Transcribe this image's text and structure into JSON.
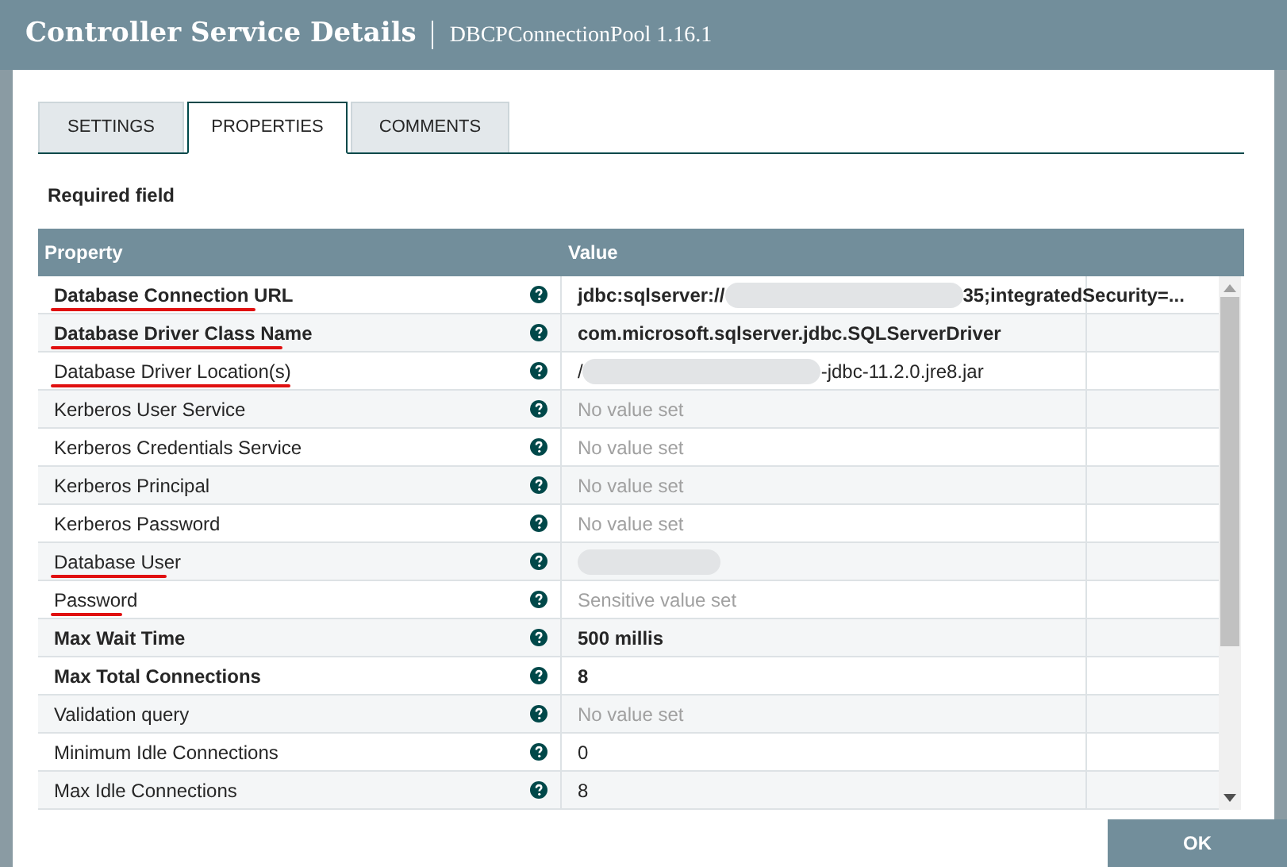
{
  "dialog": {
    "title": "Controller Service Details",
    "subtitle": "DBCPConnectionPool 1.16.1"
  },
  "tabs": [
    {
      "label": "SETTINGS",
      "selected": false
    },
    {
      "label": "PROPERTIES",
      "selected": true
    },
    {
      "label": "COMMENTS",
      "selected": false
    }
  ],
  "required_note": "Required field",
  "table": {
    "columns": [
      "Property",
      "Value"
    ],
    "rows": [
      {
        "name": "Database Connection URL",
        "required": true,
        "underlined": true,
        "value": "jdbc:sqlserver://",
        "redacted": true,
        "value_suffix": "35;integratedSecurity=...",
        "kind": "set"
      },
      {
        "name": "Database Driver Class Name",
        "required": true,
        "underlined": true,
        "value": "com.microsoft.sqlserver.jdbc.SQLServerDriver",
        "kind": "set"
      },
      {
        "name": "Database Driver Location(s)",
        "required": false,
        "underlined": true,
        "value": "/",
        "redacted": true,
        "value_suffix": "-jdbc-11.2.0.jre8.jar",
        "kind": "set"
      },
      {
        "name": "Kerberos User Service",
        "required": false,
        "underlined": false,
        "value": "No value set",
        "kind": "empty"
      },
      {
        "name": "Kerberos Credentials Service",
        "required": false,
        "underlined": false,
        "value": "No value set",
        "kind": "empty"
      },
      {
        "name": "Kerberos Principal",
        "required": false,
        "underlined": false,
        "value": "No value set",
        "kind": "empty"
      },
      {
        "name": "Kerberos Password",
        "required": false,
        "underlined": false,
        "value": "No value set",
        "kind": "empty"
      },
      {
        "name": "Database User",
        "required": false,
        "underlined": true,
        "redacted": true
      },
      {
        "name": "Password",
        "required": false,
        "underlined": true,
        "value": "Sensitive value set",
        "kind": "empty"
      },
      {
        "name": "Max Wait Time",
        "required": true,
        "underlined": false,
        "value": "500 millis",
        "kind": "set"
      },
      {
        "name": "Max Total Connections",
        "required": true,
        "underlined": false,
        "value": "8",
        "kind": "set"
      },
      {
        "name": "Validation query",
        "required": false,
        "underlined": false,
        "value": "No value set",
        "kind": "empty"
      },
      {
        "name": "Minimum Idle Connections",
        "required": false,
        "underlined": false,
        "value": "0",
        "kind": "set"
      },
      {
        "name": "Max Idle Connections",
        "required": false,
        "underlined": false,
        "value": "8",
        "kind": "set"
      }
    ]
  },
  "buttons": [
    "OK"
  ]
}
